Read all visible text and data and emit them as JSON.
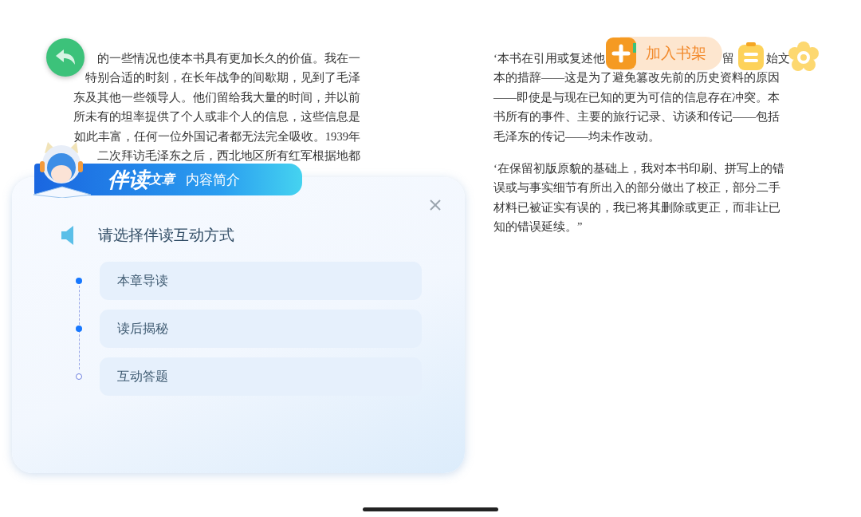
{
  "left_page": {
    "lines": [
      "的一些情况也使本书具有更加长久的价值。我在一",
      "特别合适的时刻，在长年战争的间歇期，见到了毛泽",
      "东及其他一些领导人。他们留给我大量的时间，并以前",
      "所未有的坦率提供了个人或非个人的信息，这些信息是",
      "如此丰富，任何一位外国记者都无法完全吸收。1939年",
      "二次拜访毛泽东之后，西北地区所有红军根据地都"
    ]
  },
  "right_page": {
    "paragraphs": [
      {
        "lines": [
          [
            "‘本书在引用或复述他",
            "留",
            "始文"
          ],
          [
            "本的措辞——这是为了避免篡改先前的历史资料的原因"
          ],
          [
            "——即使是与现在已知的更为可信的信息存在冲突。本"
          ],
          [
            "书所有的事件、主要的旅行记录、访谈和传记——包括"
          ],
          [
            "毛泽东的传记——均未作改动。"
          ]
        ]
      },
      {
        "lines": [
          [
            "‘在保留初版原貌的基础上，我对本书印刷、拼写上的错"
          ],
          [
            "误或与事实细节有所出入的部分做出了校正，部分二手"
          ],
          [
            "材料已被证实有误的，我已将其删除或更正，而非让已"
          ],
          [
            "知的错误延续。”"
          ]
        ]
      }
    ]
  },
  "toolbar": {
    "add_to_shelf": {
      "label": "加入书架"
    }
  },
  "panel": {
    "banner": {
      "title": "伴读",
      "title_suffix": "文章",
      "subtitle": "内容简介"
    },
    "prompt": "请选择伴读互动方式",
    "options": [
      {
        "label": "本章导读",
        "completed": true
      },
      {
        "label": "读后揭秘",
        "completed": true
      },
      {
        "label": "互动答题",
        "completed": false
      }
    ]
  }
}
